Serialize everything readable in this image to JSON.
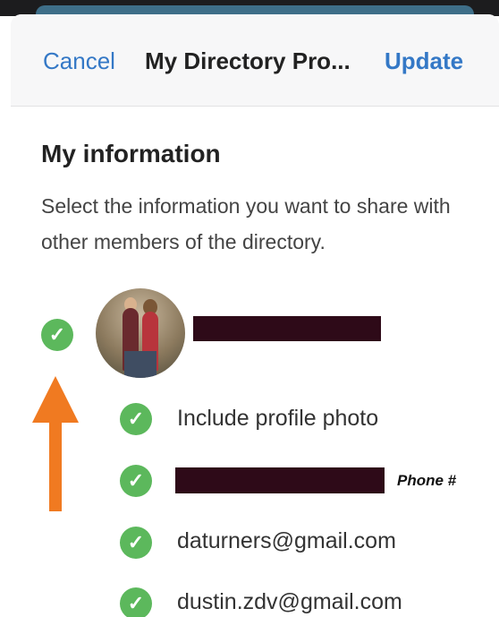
{
  "header": {
    "cancel_label": "Cancel",
    "title": "My Directory Pro...",
    "update_label": "Update"
  },
  "section": {
    "title": "My information",
    "description": "Select the information you want to share with other members of the directory."
  },
  "options": {
    "profile_photo": "Include profile photo",
    "phone_annotation": "Phone #",
    "email_1": "daturners@gmail.com",
    "email_2": "dustin.zdv@gmail.com"
  },
  "icons": {
    "check": "check-circle-icon",
    "arrow": "arrow-up-annotation"
  },
  "colors": {
    "accent": "#3478c6",
    "check": "#5cb85c",
    "annotation_arrow": "#f07a21",
    "redaction": "#2e0a18"
  }
}
